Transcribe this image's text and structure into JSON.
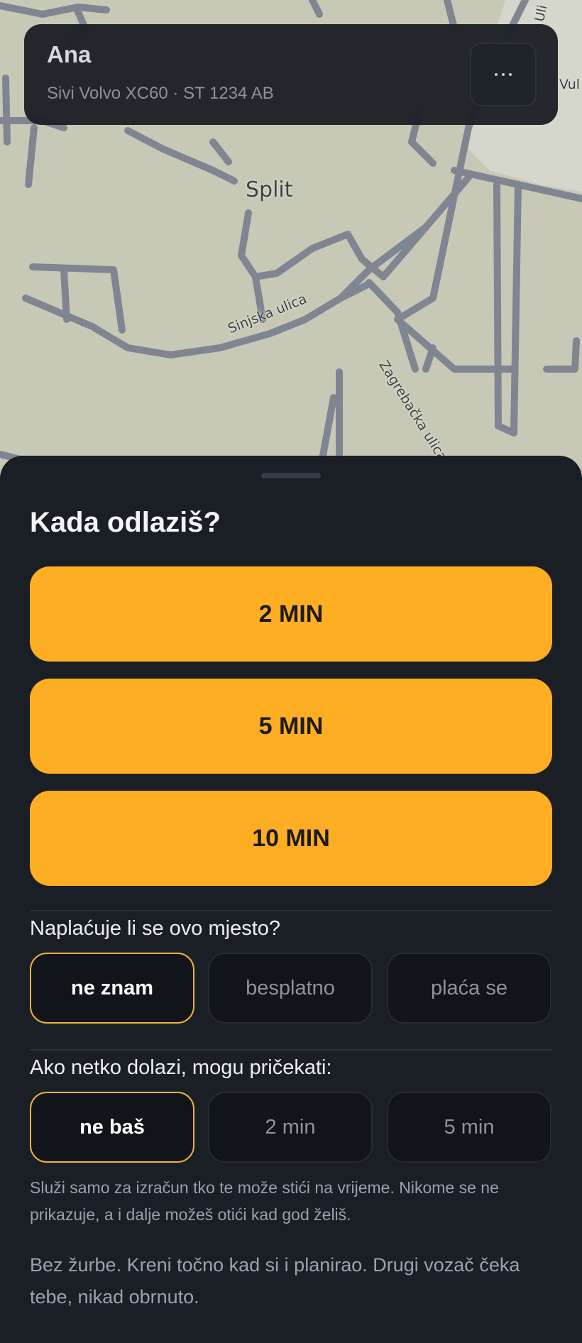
{
  "map": {
    "city_label": "Split",
    "streets": {
      "sinjska": "Sinjska ulica",
      "zagrebacka": "Zagrebačka ulica",
      "vul": "Vul",
      "uli": "Uli"
    },
    "colors": {
      "background": "#c7c9b6",
      "road": "#7f8692",
      "road_outline": "#5f6670"
    }
  },
  "driver_card": {
    "name": "Ana",
    "car": "Sivi Volvo XC60 · ST 1234 AB",
    "menu_icon": "more-dots-icon"
  },
  "sheet": {
    "title": "Kada odlaziš?",
    "time_options": [
      "2 MIN",
      "5 MIN",
      "10 MIN"
    ],
    "parking": {
      "question": "Naplaćuje li se ovo mjesto?",
      "options": [
        "ne znam",
        "besplatno",
        "plaća se"
      ],
      "selected": "ne znam"
    },
    "wait": {
      "question": "Ako netko dolazi, mogu pričekati:",
      "options": [
        "ne baš",
        "2 min",
        "5 min"
      ],
      "selected": "ne baš"
    },
    "helper_text": "Služi samo za izračun tko te može stići na vrijeme. Nikome se ne prikazuje, a i dalje možeš otići kad god želiš.",
    "reassurance_text": "Bez žurbe. Kreni točno kad si i planirao. Drugi vozač čeka tebe, nikad obrnuto."
  },
  "colors": {
    "accent": "#fdae23",
    "sheet_background": "#1a1f26",
    "selected_border": "#f2b13b"
  }
}
